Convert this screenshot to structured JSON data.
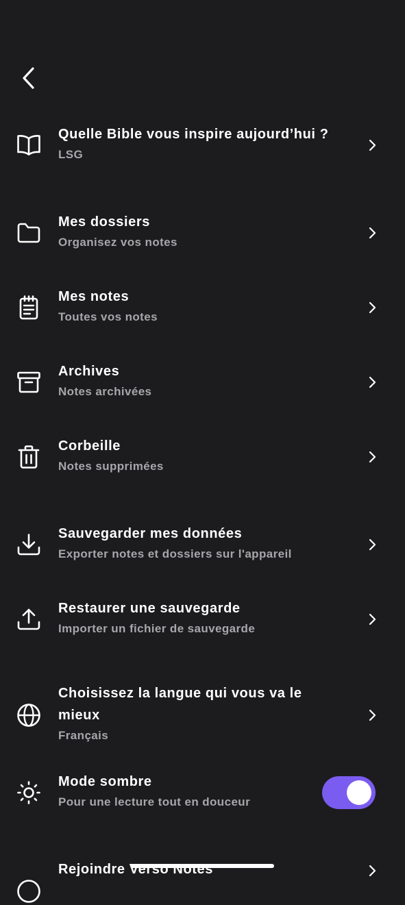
{
  "header": {
    "back_icon": "chevron-left-icon"
  },
  "menu": {
    "bible": {
      "title": "Quelle Bible vous inspire aujourd’hui ?",
      "subtitle": "LSG",
      "icon": "book-icon"
    },
    "folders": {
      "title": "Mes dossiers",
      "subtitle": "Organisez vos notes",
      "icon": "folder-icon"
    },
    "notes": {
      "title": "Mes notes",
      "subtitle": "Toutes vos notes",
      "icon": "notepad-icon"
    },
    "archives": {
      "title": "Archives",
      "subtitle": "Notes archivées",
      "icon": "archive-box-icon"
    },
    "trash": {
      "title": "Corbeille",
      "subtitle": "Notes supprimées",
      "icon": "trash-icon"
    },
    "backup": {
      "title": "Sauvegarder mes données",
      "subtitle": "Exporter notes et dossiers sur l'appareil",
      "icon": "download-icon"
    },
    "restore": {
      "title": "Restaurer une sauvegarde",
      "subtitle": "Importer un fichier de sauvegarde",
      "icon": "upload-icon"
    },
    "language": {
      "title": "Choisissez la langue qui vous va le mieux",
      "subtitle": "Français",
      "icon": "globe-icon"
    },
    "dark_mode": {
      "title": "Mode sombre",
      "subtitle": "Pour une lecture tout en douceur",
      "icon": "sun-icon",
      "enabled": true
    },
    "join": {
      "title": "Rejoindre Verso Notes",
      "icon": "circle-icon"
    }
  },
  "colors": {
    "background": "#1c1c1e",
    "text_primary": "#ffffff",
    "text_secondary": "#a7a7ab",
    "accent": "#7b5cf0"
  }
}
